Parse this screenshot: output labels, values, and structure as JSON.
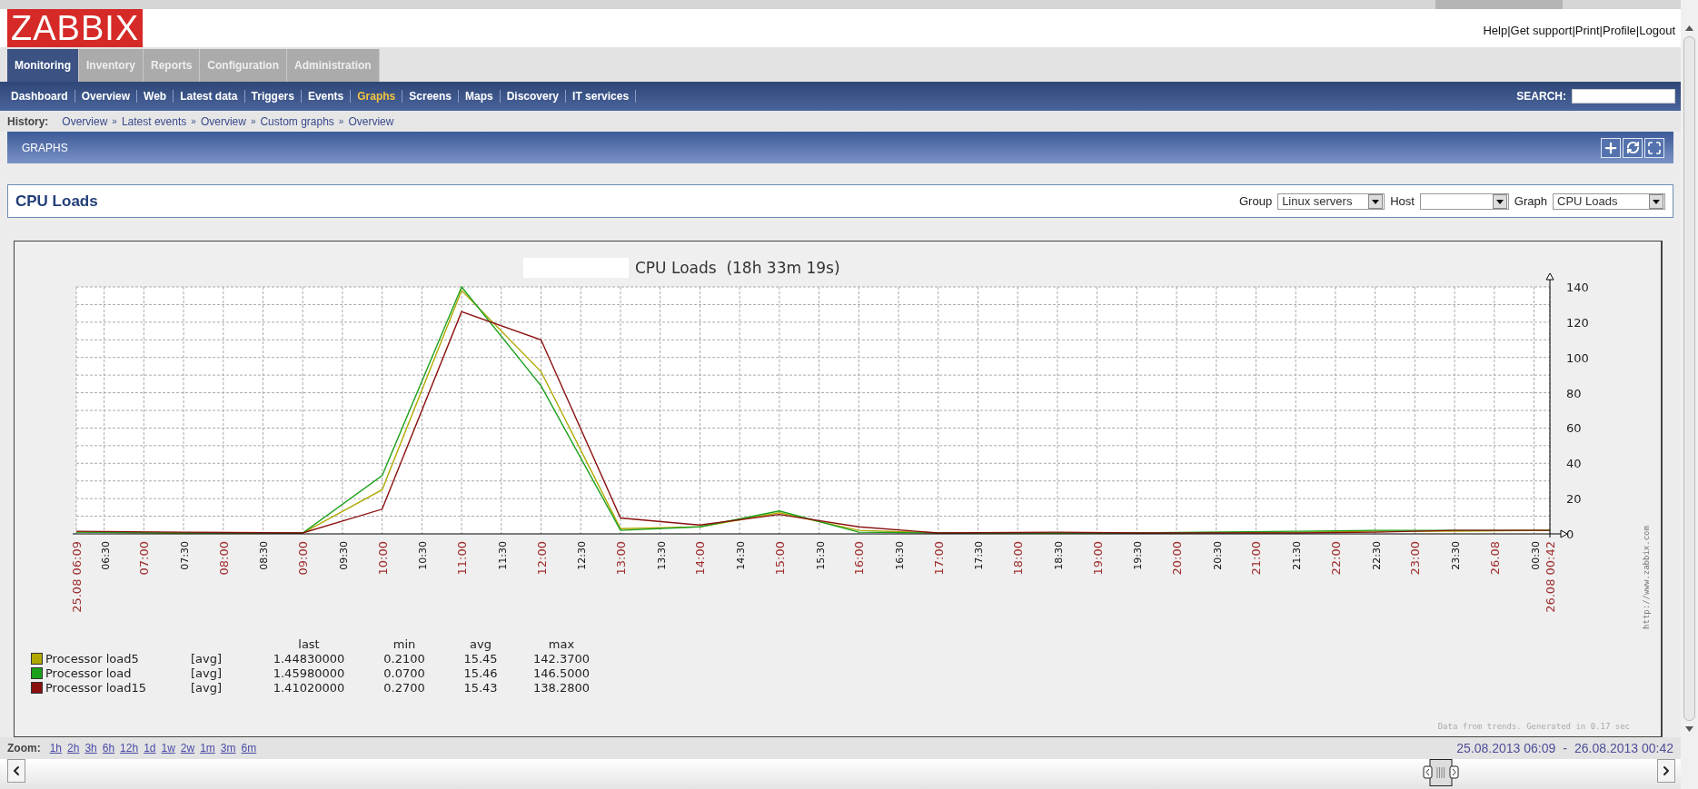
{
  "header": {
    "logo": "ZABBIX",
    "separator": "|",
    "links": [
      "Help",
      "Get support",
      "Print",
      "Profile",
      "Logout"
    ]
  },
  "main_tabs": [
    {
      "label": "Monitoring",
      "selected": true
    },
    {
      "label": "Inventory",
      "selected": false
    },
    {
      "label": "Reports",
      "selected": false
    },
    {
      "label": "Configuration",
      "selected": false
    },
    {
      "label": "Administration",
      "selected": false
    }
  ],
  "sub_menu": [
    {
      "label": "Dashboard",
      "selected": false
    },
    {
      "label": "Overview",
      "selected": false
    },
    {
      "label": "Web",
      "selected": false
    },
    {
      "label": "Latest data",
      "selected": false
    },
    {
      "label": "Triggers",
      "selected": false
    },
    {
      "label": "Events",
      "selected": false
    },
    {
      "label": "Graphs",
      "selected": true
    },
    {
      "label": "Screens",
      "selected": false
    },
    {
      "label": "Maps",
      "selected": false
    },
    {
      "label": "Discovery",
      "selected": false
    },
    {
      "label": "IT services",
      "selected": false
    }
  ],
  "search": {
    "label": "SEARCH:"
  },
  "history": {
    "label": "History:",
    "separator": "»",
    "items": [
      "Overview",
      "Latest events",
      "Overview",
      "Custom graphs",
      "Overview"
    ]
  },
  "section": {
    "title": "GRAPHS"
  },
  "graph_panel": {
    "title": "CPU Loads",
    "filters": [
      {
        "label": "Group",
        "value": "Linux servers"
      },
      {
        "label": "Host"
      },
      {
        "label": "Graph",
        "value": "CPU Loads"
      }
    ]
  },
  "graph": {
    "title": "CPU Loads  (18h 33m 19s)",
    "url": "http://www.zabbix.com",
    "footer": "Data from trends. Generated in 0.17 sec",
    "chart_data": {
      "type": "line",
      "grid": true,
      "xlim": [
        "2013-08-25T06:09",
        "2013-08-26T00:42"
      ],
      "ylim": [
        0,
        140
      ],
      "x": [
        "2013-08-25T06:09",
        "2013-08-25T07:30",
        "2013-08-25T09:00",
        "2013-08-25T10:00",
        "2013-08-25T11:00",
        "2013-08-25T12:00",
        "2013-08-25T13:00",
        "2013-08-25T14:00",
        "2013-08-25T15:00",
        "2013-08-25T16:00",
        "2013-08-25T17:00",
        "2013-08-25T18:30",
        "2013-08-25T19:30",
        "2013-08-25T21:30",
        "2013-08-25T22:30",
        "2013-08-25T23:30",
        "2013-08-26T00:42"
      ],
      "series": [
        {
          "name": "Processor load5",
          "color": "#b0a800",
          "values": [
            1,
            0.5,
            0.5,
            25,
            138,
            92,
            3,
            4,
            12,
            2,
            0.5,
            0.5,
            0.5,
            1,
            1.5,
            1.5,
            2
          ]
        },
        {
          "name": "Processor load",
          "color": "#1aa01a",
          "values": [
            1,
            0.5,
            0.5,
            33,
            140,
            84,
            2,
            4,
            13,
            1,
            0.5,
            0.5,
            0.5,
            1.5,
            2,
            2,
            2
          ]
        },
        {
          "name": "Processor load15",
          "color": "#8a1010",
          "values": [
            1.5,
            1,
            0.5,
            14,
            126,
            110,
            9,
            5,
            11,
            4,
            0.5,
            1,
            0.5,
            0.5,
            1,
            2,
            2
          ]
        }
      ],
      "yticks": [
        0,
        20,
        40,
        60,
        80,
        100,
        120,
        140
      ],
      "xticks": [
        {
          "value": "2013-08-25T06:09",
          "label": "25.08 06:09"
        },
        {
          "value": "2013-08-25T06:30",
          "label": "06:30"
        },
        {
          "value": "2013-08-25T07:00",
          "label": "07:00"
        },
        {
          "value": "2013-08-25T07:30",
          "label": "07:30"
        },
        {
          "value": "2013-08-25T08:00",
          "label": "08:00"
        },
        {
          "value": "2013-08-25T08:30",
          "label": "08:30"
        },
        {
          "value": "2013-08-25T09:00",
          "label": "09:00"
        },
        {
          "value": "2013-08-25T09:30",
          "label": "09:30"
        },
        {
          "value": "2013-08-25T10:00",
          "label": "10:00"
        },
        {
          "value": "2013-08-25T10:30",
          "label": "10:30"
        },
        {
          "value": "2013-08-25T11:00",
          "label": "11:00"
        },
        {
          "value": "2013-08-25T11:30",
          "label": "11:30"
        },
        {
          "value": "2013-08-25T12:00",
          "label": "12:00"
        },
        {
          "value": "2013-08-25T12:30",
          "label": "12:30"
        },
        {
          "value": "2013-08-25T13:00",
          "label": "13:00"
        },
        {
          "value": "2013-08-25T13:30",
          "label": "13:30"
        },
        {
          "value": "2013-08-25T14:00",
          "label": "14:00"
        },
        {
          "value": "2013-08-25T14:30",
          "label": "14:30"
        },
        {
          "value": "2013-08-25T15:00",
          "label": "15:00"
        },
        {
          "value": "2013-08-25T15:30",
          "label": "15:30"
        },
        {
          "value": "2013-08-25T16:00",
          "label": "16:00"
        },
        {
          "value": "2013-08-25T16:30",
          "label": "16:30"
        },
        {
          "value": "2013-08-25T17:00",
          "label": "17:00"
        },
        {
          "value": "2013-08-25T17:30",
          "label": "17:30"
        },
        {
          "value": "2013-08-25T18:00",
          "label": "18:00"
        },
        {
          "value": "2013-08-25T18:30",
          "label": "18:30"
        },
        {
          "value": "2013-08-25T19:00",
          "label": "19:00"
        },
        {
          "value": "2013-08-25T19:30",
          "label": "19:30"
        },
        {
          "value": "2013-08-25T20:00",
          "label": "20:00"
        },
        {
          "value": "2013-08-25T20:30",
          "label": "20:30"
        },
        {
          "value": "2013-08-25T21:00",
          "label": "21:00"
        },
        {
          "value": "2013-08-25T21:30",
          "label": "21:30"
        },
        {
          "value": "2013-08-25T22:00",
          "label": "22:00"
        },
        {
          "value": "2013-08-25T22:30",
          "label": "22:30"
        },
        {
          "value": "2013-08-25T23:00",
          "label": "23:00"
        },
        {
          "value": "2013-08-25T23:30",
          "label": "23:30"
        },
        {
          "value": "2013-08-26T00:00",
          "label": "26.08"
        },
        {
          "value": "2013-08-26T00:30",
          "label": "00:30"
        },
        {
          "value": "2013-08-26T00:42",
          "label": "26.08 00:42"
        }
      ]
    },
    "legend": {
      "columns": [
        "last",
        "min",
        "avg",
        "max"
      ],
      "rows": [
        {
          "function": "[avg]",
          "last": "1.44830000",
          "min": "0.2100",
          "avg": "15.45",
          "max": "142.3700"
        },
        {
          "function": "[avg]",
          "last": "1.45980000",
          "min": "0.0700",
          "avg": "15.46",
          "max": "146.5000"
        },
        {
          "function": "[avg]",
          "last": "1.41020000",
          "min": "0.2700",
          "avg": "15.43",
          "max": "138.2800"
        }
      ]
    }
  },
  "zoom": {
    "label": "Zoom:",
    "options": [
      "1h",
      "2h",
      "3h",
      "6h",
      "12h",
      "1d",
      "1w",
      "2w",
      "1m",
      "3m",
      "6m"
    ]
  },
  "period": {
    "from": "25.08.2013 06:09",
    "separator": "-",
    "to": "26.08.2013 00:42"
  }
}
